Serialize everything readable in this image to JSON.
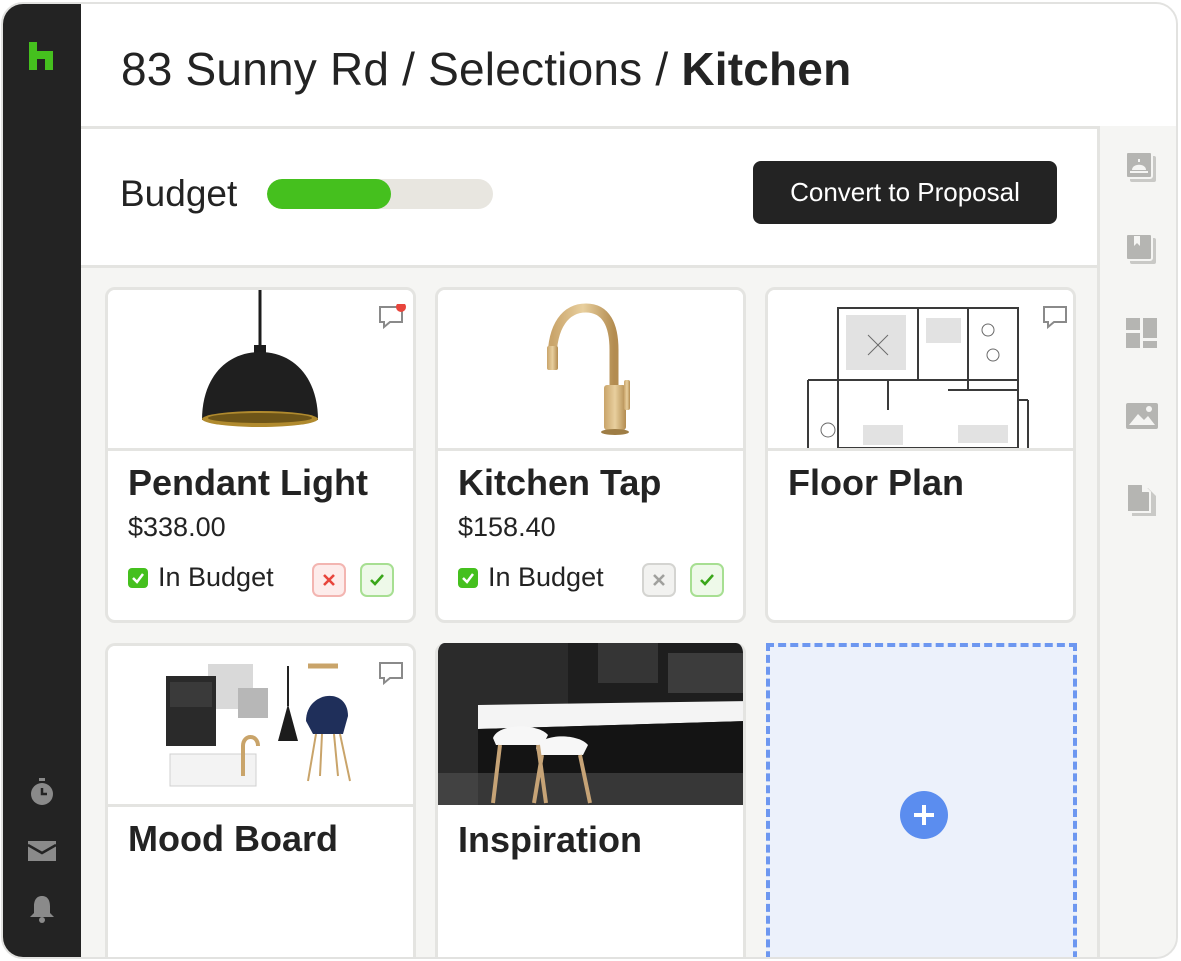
{
  "breadcrumb": {
    "project": "83 Sunny Rd",
    "separator": " / ",
    "section": "Selections",
    "current": "Kitchen"
  },
  "budget": {
    "label": "Budget",
    "progress_fraction": 0.55
  },
  "actions": {
    "convert_label": "Convert to Proposal"
  },
  "cards": [
    {
      "title": "Pendant Light",
      "price": "$338.00",
      "status": "In Budget",
      "has_new_comment": true
    },
    {
      "title": "Kitchen Tap",
      "price": "$158.40",
      "status": "In Budget",
      "has_new_comment": false
    },
    {
      "title": "Floor Plan"
    },
    {
      "title": "Mood Board"
    },
    {
      "title": "Inspiration"
    }
  ],
  "colors": {
    "sidebar": "#232323",
    "brand_green": "#45c01e",
    "accent_blue": "#5b8def",
    "reject_red": "#e8453c"
  },
  "icons": {
    "sidebar": [
      "houzz-logo-icon",
      "stopwatch-icon",
      "inbox-icon",
      "bell-icon"
    ],
    "rail": [
      "service-bell-icon",
      "book-icon",
      "layout-icon",
      "image-icon",
      "documents-icon"
    ]
  }
}
